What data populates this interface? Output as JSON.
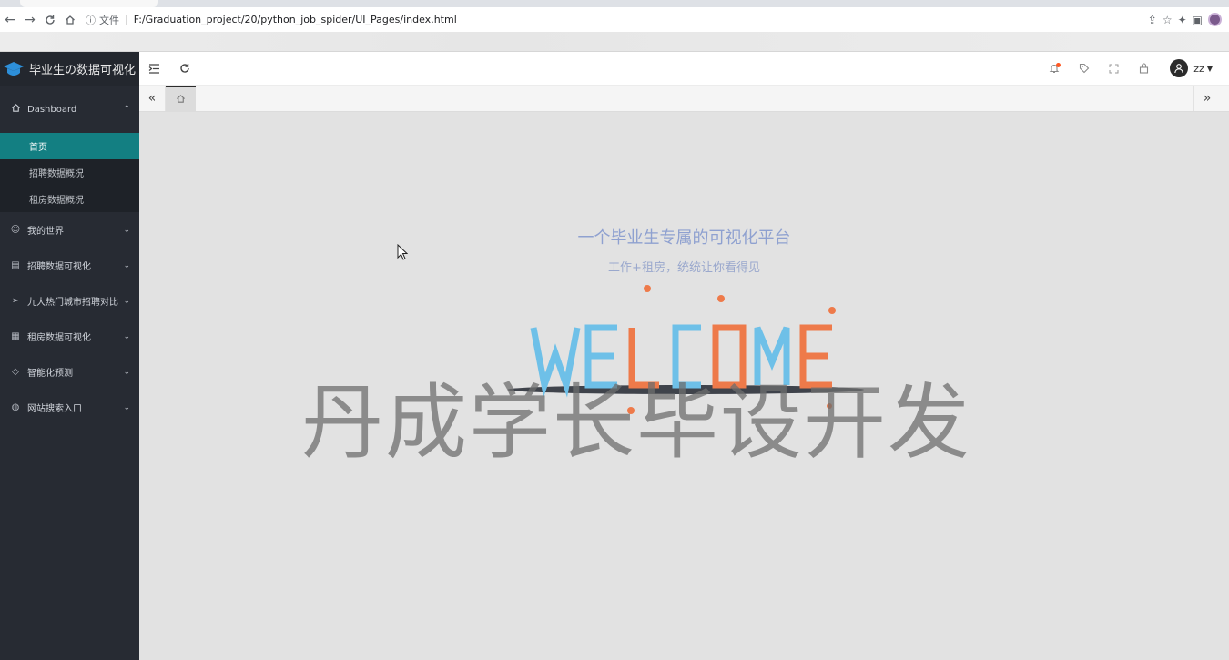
{
  "browser": {
    "address_scheme": "文件",
    "address_url": "F:/Graduation_project/20/python_job_spider/UI_Pages/index.html"
  },
  "app": {
    "title": "毕业生の数据可视化"
  },
  "sidebar": {
    "dashboard": {
      "label": "Dashboard",
      "icon": "home-icon"
    },
    "dashboard_sub": [
      {
        "label": "首页",
        "active": true
      },
      {
        "label": "招聘数据概况",
        "active": false
      },
      {
        "label": "租房数据概况",
        "active": false
      }
    ],
    "items": [
      {
        "label": "我的世界",
        "icon": "smile-icon"
      },
      {
        "label": "招聘数据可视化",
        "icon": "calendar-icon"
      },
      {
        "label": "九大热门城市招聘对比",
        "icon": "send-icon"
      },
      {
        "label": "租房数据可视化",
        "icon": "table-icon"
      },
      {
        "label": "智能化预测",
        "icon": "diamond-icon"
      },
      {
        "label": "网站搜索入口",
        "icon": "globe-icon"
      }
    ],
    "active_color": "#137f82"
  },
  "header": {
    "username": "zz"
  },
  "welcome": {
    "title": "一个毕业生专属的可视化平台",
    "subtitle": "工作+租房，统统让你看得见",
    "word": "WELCOME",
    "colors": {
      "blue": "#6ec0e8",
      "orange": "#ee7a4a"
    }
  },
  "watermark": "丹成学长毕设开发"
}
